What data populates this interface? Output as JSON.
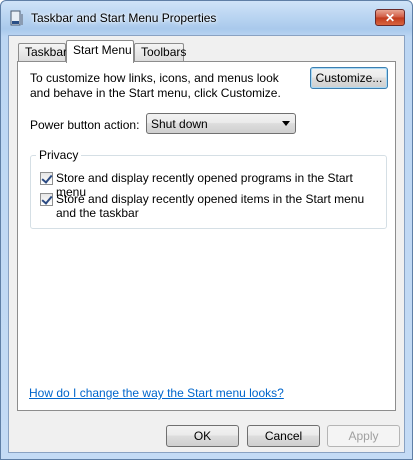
{
  "window": {
    "title": "Taskbar and Start Menu Properties",
    "close_label": "✕"
  },
  "tabs": [
    {
      "label": "Taskbar"
    },
    {
      "label": "Start Menu",
      "active": true
    },
    {
      "label": "Toolbars"
    }
  ],
  "start_menu": {
    "intro_text": "To customize how links, icons, and menus look and behave in the Start menu, click Customize.",
    "customize_label": "Customize...",
    "power_label": "Power button action:",
    "power_value": "Shut down",
    "privacy": {
      "label": "Privacy",
      "items": [
        {
          "label": "Store and display recently opened programs in the Start menu",
          "checked": true
        },
        {
          "label": "Store and display recently opened items in the Start menu and the taskbar",
          "checked": true
        }
      ]
    },
    "help_link": "How do I change the way the Start menu looks?"
  },
  "buttons": {
    "ok": "OK",
    "cancel": "Cancel",
    "apply": "Apply"
  },
  "colors": {
    "link": "#0066cc",
    "close_button": "#c0391c"
  }
}
